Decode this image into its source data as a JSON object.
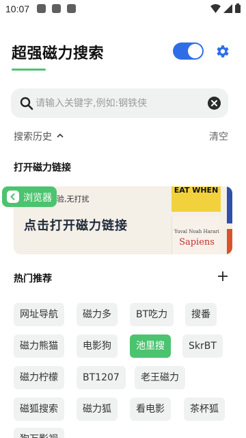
{
  "status_bar": {
    "time": "10:07"
  },
  "header": {
    "title": "超强磁力搜索",
    "toggle_on": true,
    "accent_color": "#4cc36f",
    "toggle_color": "#2f6de8"
  },
  "search": {
    "placeholder": "请输入关键字,例如:钢铁侠",
    "value": ""
  },
  "history": {
    "label": "搜索历史",
    "clear_label": "清空"
  },
  "open_link": {
    "title": "打开磁力链接",
    "banner_caption": "体验,无打扰",
    "banner_text": "点击打开磁力链接",
    "browser_label": "浏览器",
    "book1_text": "EAT WHEN",
    "book2_author": "Yuval Noah Harari",
    "book2_title": "Sapiens"
  },
  "hot": {
    "title": "热门推荐",
    "tags": [
      "网址导航",
      "磁力多",
      "BT吃力",
      "搜番",
      "磁力熊猫",
      "电影狗",
      "池里搜",
      "SkrBT",
      "磁力柠檬",
      "BT1207",
      "老王磁力",
      "磁狐搜索",
      "磁力狐",
      "看电影",
      "茶杯狐",
      "狗万影视"
    ],
    "active_tag": "池里搜"
  }
}
